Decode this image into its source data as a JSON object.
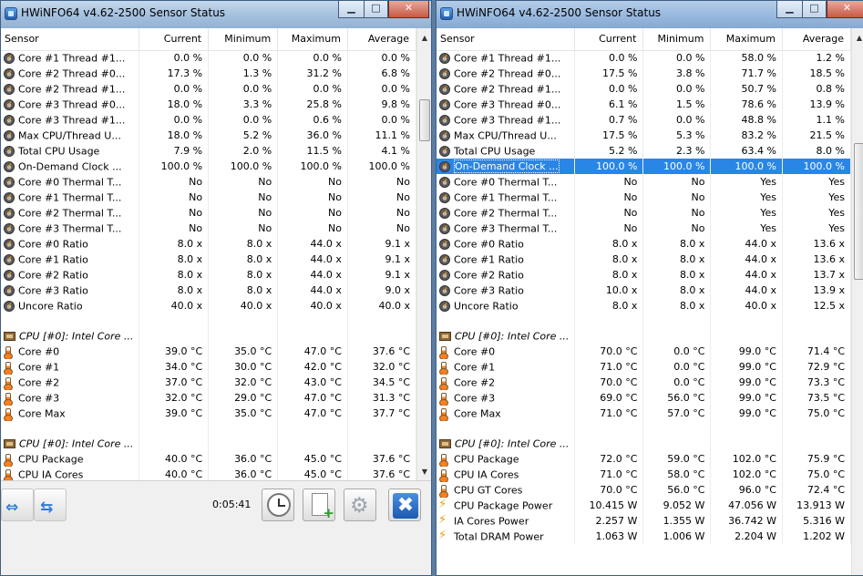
{
  "windows": [
    {
      "title": "HWiNFO64 v4.62-2500 Sensor Status",
      "columns": [
        "Sensor",
        "Current",
        "Minimum",
        "Maximum",
        "Average"
      ],
      "rows": [
        {
          "icon": "gauge",
          "name": "Core #1 Thread #1...",
          "v": [
            "0.0 %",
            "0.0 %",
            "0.0 %",
            "0.0 %"
          ]
        },
        {
          "icon": "gauge",
          "name": "Core #2 Thread #0...",
          "v": [
            "17.3 %",
            "1.3 %",
            "31.2 %",
            "6.8 %"
          ]
        },
        {
          "icon": "gauge",
          "name": "Core #2 Thread #1...",
          "v": [
            "0.0 %",
            "0.0 %",
            "0.0 %",
            "0.0 %"
          ]
        },
        {
          "icon": "gauge",
          "name": "Core #3 Thread #0...",
          "v": [
            "18.0 %",
            "3.3 %",
            "25.8 %",
            "9.8 %"
          ]
        },
        {
          "icon": "gauge",
          "name": "Core #3 Thread #1...",
          "v": [
            "0.0 %",
            "0.0 %",
            "0.6 %",
            "0.0 %"
          ]
        },
        {
          "icon": "gauge",
          "name": "Max CPU/Thread U...",
          "v": [
            "18.0 %",
            "5.2 %",
            "36.0 %",
            "11.1 %"
          ]
        },
        {
          "icon": "gauge",
          "name": "Total CPU Usage",
          "v": [
            "7.9 %",
            "2.0 %",
            "11.5 %",
            "4.1 %"
          ]
        },
        {
          "icon": "gauge",
          "name": "On-Demand Clock ...",
          "v": [
            "100.0 %",
            "100.0 %",
            "100.0 %",
            "100.0 %"
          ]
        },
        {
          "icon": "gauge",
          "name": "Core #0 Thermal T...",
          "v": [
            "No",
            "No",
            "No",
            "No"
          ]
        },
        {
          "icon": "gauge",
          "name": "Core #1 Thermal T...",
          "v": [
            "No",
            "No",
            "No",
            "No"
          ]
        },
        {
          "icon": "gauge",
          "name": "Core #2 Thermal T...",
          "v": [
            "No",
            "No",
            "No",
            "No"
          ]
        },
        {
          "icon": "gauge",
          "name": "Core #3 Thermal T...",
          "v": [
            "No",
            "No",
            "No",
            "No"
          ]
        },
        {
          "icon": "gauge",
          "name": "Core #0 Ratio",
          "v": [
            "8.0 x",
            "8.0 x",
            "44.0 x",
            "9.1 x"
          ]
        },
        {
          "icon": "gauge",
          "name": "Core #1 Ratio",
          "v": [
            "8.0 x",
            "8.0 x",
            "44.0 x",
            "9.1 x"
          ]
        },
        {
          "icon": "gauge",
          "name": "Core #2 Ratio",
          "v": [
            "8.0 x",
            "8.0 x",
            "44.0 x",
            "9.1 x"
          ]
        },
        {
          "icon": "gauge",
          "name": "Core #3 Ratio",
          "v": [
            "8.0 x",
            "8.0 x",
            "44.0 x",
            "9.0 x"
          ]
        },
        {
          "icon": "gauge",
          "name": "Uncore Ratio",
          "v": [
            "40.0 x",
            "40.0 x",
            "40.0 x",
            "40.0 x"
          ]
        },
        {
          "spacer": true
        },
        {
          "icon": "chip",
          "name": "CPU [#0]: Intel Core ...",
          "header": true,
          "v": [
            "",
            "",
            "",
            ""
          ]
        },
        {
          "icon": "therm",
          "name": "Core #0",
          "v": [
            "39.0 °C",
            "35.0 °C",
            "47.0 °C",
            "37.6 °C"
          ]
        },
        {
          "icon": "therm",
          "name": "Core #1",
          "v": [
            "34.0 °C",
            "30.0 °C",
            "42.0 °C",
            "32.0 °C"
          ]
        },
        {
          "icon": "therm",
          "name": "Core #2",
          "v": [
            "37.0 °C",
            "32.0 °C",
            "43.0 °C",
            "34.5 °C"
          ]
        },
        {
          "icon": "therm",
          "name": "Core #3",
          "v": [
            "32.0 °C",
            "29.0 °C",
            "47.0 °C",
            "31.3 °C"
          ]
        },
        {
          "icon": "therm",
          "name": "Core Max",
          "v": [
            "39.0 °C",
            "35.0 °C",
            "47.0 °C",
            "37.7 °C"
          ]
        },
        {
          "spacer": true
        },
        {
          "icon": "chip",
          "name": "CPU [#0]: Intel Core ...",
          "header": true,
          "v": [
            "",
            "",
            "",
            ""
          ]
        },
        {
          "icon": "therm",
          "name": "CPU Package",
          "v": [
            "40.0 °C",
            "36.0 °C",
            "45.0 °C",
            "37.6 °C"
          ]
        },
        {
          "icon": "therm",
          "name": "CPU IA Cores",
          "v": [
            "40.0 °C",
            "36.0 °C",
            "45.0 °C",
            "37.6 °C"
          ]
        }
      ],
      "timer": "0:05:41"
    },
    {
      "title": "HWiNFO64 v4.62-2500 Sensor Status",
      "columns": [
        "Sensor",
        "Current",
        "Minimum",
        "Maximum",
        "Average"
      ],
      "rows": [
        {
          "icon": "gauge",
          "name": "Core #1 Thread #1...",
          "v": [
            "0.0 %",
            "0.0 %",
            "58.0 %",
            "1.2 %"
          ]
        },
        {
          "icon": "gauge",
          "name": "Core #2 Thread #0...",
          "v": [
            "17.5 %",
            "3.8 %",
            "71.7 %",
            "18.5 %"
          ]
        },
        {
          "icon": "gauge",
          "name": "Core #2 Thread #1...",
          "v": [
            "0.0 %",
            "0.0 %",
            "50.7 %",
            "0.8 %"
          ]
        },
        {
          "icon": "gauge",
          "name": "Core #3 Thread #0...",
          "v": [
            "6.1 %",
            "1.5 %",
            "78.6 %",
            "13.9 %"
          ]
        },
        {
          "icon": "gauge",
          "name": "Core #3 Thread #1...",
          "v": [
            "0.7 %",
            "0.0 %",
            "48.8 %",
            "1.1 %"
          ]
        },
        {
          "icon": "gauge",
          "name": "Max CPU/Thread U...",
          "v": [
            "17.5 %",
            "5.3 %",
            "83.2 %",
            "21.5 %"
          ]
        },
        {
          "icon": "gauge",
          "name": "Total CPU Usage",
          "v": [
            "5.2 %",
            "2.3 %",
            "63.4 %",
            "8.0 %"
          ]
        },
        {
          "icon": "gauge",
          "name": "On-Demand Clock ...",
          "selected": true,
          "v": [
            "100.0 %",
            "100.0 %",
            "100.0 %",
            "100.0 %"
          ]
        },
        {
          "icon": "gauge",
          "name": "Core #0 Thermal T...",
          "v": [
            "No",
            "No",
            "Yes",
            "Yes"
          ]
        },
        {
          "icon": "gauge",
          "name": "Core #1 Thermal T...",
          "v": [
            "No",
            "No",
            "Yes",
            "Yes"
          ]
        },
        {
          "icon": "gauge",
          "name": "Core #2 Thermal T...",
          "v": [
            "No",
            "No",
            "Yes",
            "Yes"
          ]
        },
        {
          "icon": "gauge",
          "name": "Core #3 Thermal T...",
          "v": [
            "No",
            "No",
            "Yes",
            "Yes"
          ]
        },
        {
          "icon": "gauge",
          "name": "Core #0 Ratio",
          "v": [
            "8.0 x",
            "8.0 x",
            "44.0 x",
            "13.6 x"
          ]
        },
        {
          "icon": "gauge",
          "name": "Core #1 Ratio",
          "v": [
            "8.0 x",
            "8.0 x",
            "44.0 x",
            "13.6 x"
          ]
        },
        {
          "icon": "gauge",
          "name": "Core #2 Ratio",
          "v": [
            "8.0 x",
            "8.0 x",
            "44.0 x",
            "13.7 x"
          ]
        },
        {
          "icon": "gauge",
          "name": "Core #3 Ratio",
          "v": [
            "10.0 x",
            "8.0 x",
            "44.0 x",
            "13.9 x"
          ]
        },
        {
          "icon": "gauge",
          "name": "Uncore Ratio",
          "v": [
            "8.0 x",
            "8.0 x",
            "40.0 x",
            "12.5 x"
          ]
        },
        {
          "spacer": true
        },
        {
          "icon": "chip",
          "name": "CPU [#0]: Intel Core ...",
          "header": true,
          "v": [
            "",
            "",
            "",
            ""
          ]
        },
        {
          "icon": "therm",
          "name": "Core #0",
          "v": [
            "70.0 °C",
            "0.0 °C",
            "99.0 °C",
            "71.4 °C"
          ]
        },
        {
          "icon": "therm",
          "name": "Core #1",
          "v": [
            "71.0 °C",
            "0.0 °C",
            "99.0 °C",
            "72.9 °C"
          ]
        },
        {
          "icon": "therm",
          "name": "Core #2",
          "v": [
            "70.0 °C",
            "0.0 °C",
            "99.0 °C",
            "73.3 °C"
          ]
        },
        {
          "icon": "therm",
          "name": "Core #3",
          "v": [
            "69.0 °C",
            "56.0 °C",
            "99.0 °C",
            "73.5 °C"
          ]
        },
        {
          "icon": "therm",
          "name": "Core Max",
          "v": [
            "71.0 °C",
            "57.0 °C",
            "99.0 °C",
            "75.0 °C"
          ]
        },
        {
          "spacer": true
        },
        {
          "icon": "chip",
          "name": "CPU [#0]: Intel Core ...",
          "header": true,
          "v": [
            "",
            "",
            "",
            ""
          ]
        },
        {
          "icon": "therm",
          "name": "CPU Package",
          "v": [
            "72.0 °C",
            "59.0 °C",
            "102.0 °C",
            "75.9 °C"
          ]
        },
        {
          "icon": "therm",
          "name": "CPU IA Cores",
          "v": [
            "71.0 °C",
            "58.0 °C",
            "102.0 °C",
            "75.0 °C"
          ]
        },
        {
          "icon": "therm",
          "name": "CPU GT Cores",
          "v": [
            "70.0 °C",
            "56.0 °C",
            "96.0 °C",
            "72.4 °C"
          ]
        },
        {
          "icon": "bolt",
          "name": "CPU Package Power",
          "v": [
            "10.415 W",
            "9.052 W",
            "47.056 W",
            "13.913 W"
          ]
        },
        {
          "icon": "bolt",
          "name": "IA Cores Power",
          "v": [
            "2.257 W",
            "1.355 W",
            "36.742 W",
            "5.316 W"
          ]
        },
        {
          "icon": "bolt",
          "name": "Total DRAM Power",
          "v": [
            "1.063 W",
            "1.006 W",
            "2.204 W",
            "1.202 W"
          ]
        }
      ]
    }
  ],
  "controls": {
    "minimize": "▁",
    "maximize": "□",
    "close": "✕"
  },
  "icons": {
    "scroll_up": "▲",
    "scroll_down": "▼",
    "nav_expand": "⇔",
    "nav_collapse": "⇆",
    "settings": "⚙",
    "close_x": "✖"
  }
}
